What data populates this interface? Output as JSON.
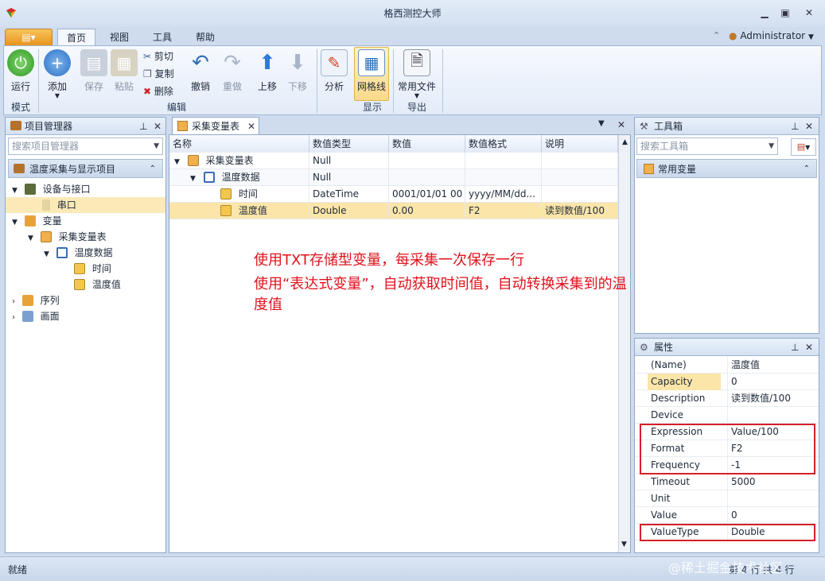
{
  "app": {
    "title": "格西测控大师"
  },
  "ribbon_tabs": [
    "首页",
    "视图",
    "工具",
    "帮助"
  ],
  "user": {
    "name": "Administrator"
  },
  "ribbon": {
    "run": "运行",
    "add": "添加",
    "save": "保存",
    "paste": "粘贴",
    "cut": "剪切",
    "copy": "复制",
    "delete": "删除",
    "undo": "撤销",
    "redo": "重做",
    "move_up": "上移",
    "move_down": "下移",
    "analyze": "分析",
    "gridlines": "网格线",
    "common_files": "常用文件",
    "groups": {
      "mode": "模式",
      "edit": "编辑",
      "display": "显示",
      "export": "导出"
    }
  },
  "project_panel": {
    "title": "项目管理器",
    "search_placeholder": "搜索项目管理器",
    "project_name": "温度采集与显示项目",
    "tree": [
      {
        "label": "设备与接口",
        "children": [
          {
            "label": "串口"
          }
        ]
      },
      {
        "label": "变量",
        "children": [
          {
            "label": "采集变量表",
            "children": [
              {
                "label": "温度数据",
                "children": [
                  {
                    "label": "时间"
                  },
                  {
                    "label": "温度值"
                  }
                ]
              }
            ]
          }
        ]
      },
      {
        "label": "序列"
      },
      {
        "label": "画面"
      }
    ]
  },
  "doc_tab": {
    "title": "采集变量表"
  },
  "grid": {
    "columns": [
      "名称",
      "数值类型",
      "数值",
      "数值格式",
      "说明"
    ],
    "rows": [
      {
        "name": "采集变量表",
        "type": "Null",
        "value": "",
        "format": "",
        "desc": ""
      },
      {
        "name": "温度数据",
        "type": "Null",
        "value": "",
        "format": "",
        "desc": ""
      },
      {
        "name": "时间",
        "type": "DateTime",
        "value": "0001/01/01 00",
        "format": "yyyy/MM/dd...",
        "desc": ""
      },
      {
        "name": "温度值",
        "type": "Double",
        "value": "0.00",
        "format": "F2",
        "desc": "读到数值/100"
      }
    ]
  },
  "annotation": {
    "line1": "使用TXT存储型变量，每采集一次保存一行",
    "line2": "使用“表达式变量”，自动获取时间值，自动转换采集到的温度值"
  },
  "toolbox": {
    "title": "工具箱",
    "search_placeholder": "搜索工具箱",
    "section": "常用变量"
  },
  "properties": {
    "title": "属性",
    "rows": [
      {
        "name": "(Name)",
        "value": "温度值"
      },
      {
        "name": "Capacity",
        "value": "0"
      },
      {
        "name": "Description",
        "value": "读到数值/100"
      },
      {
        "name": "Device",
        "value": ""
      },
      {
        "name": "Expression",
        "value": "Value/100"
      },
      {
        "name": "Format",
        "value": "F2"
      },
      {
        "name": "Frequency",
        "value": "-1"
      },
      {
        "name": "Timeout",
        "value": "5000"
      },
      {
        "name": "Unit",
        "value": ""
      },
      {
        "name": "Value",
        "value": "0"
      },
      {
        "name": "ValueType",
        "value": "Double"
      }
    ]
  },
  "status": {
    "text": "就绪",
    "right": "第 4 行 共 4 行"
  },
  "watermark": "@稀土掘金技术社区"
}
